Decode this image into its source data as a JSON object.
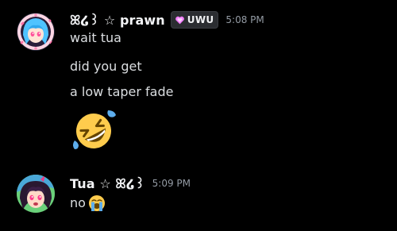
{
  "messages": [
    {
      "author": "ꕤ໒꒱ ☆ prawn",
      "tag": "UWU",
      "timestamp": "5:08 PM",
      "lines": [
        "wait tua",
        "did you get",
        "a low taper fade"
      ],
      "reaction_emoji": "rolling-on-floor-laughing-icon"
    },
    {
      "author": "Tua ☆ ꕤ໒꒱",
      "timestamp": "5:09 PM",
      "lines": [
        "no"
      ],
      "inline_emoji": "loudly-crying-face-icon"
    }
  ],
  "colors": {
    "background": "#000000",
    "username": "#f2f3f5",
    "text": "#dbdee1",
    "timestamp": "#949ba4",
    "tag_heart": "#f47fff"
  }
}
